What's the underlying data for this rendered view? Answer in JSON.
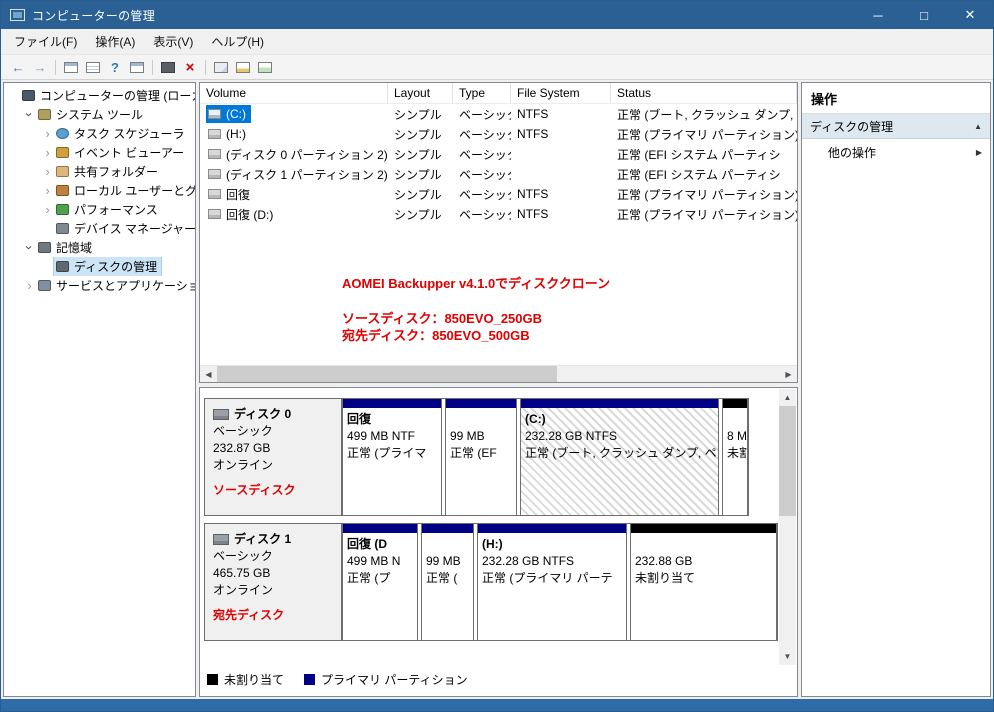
{
  "window": {
    "title": "コンピューターの管理",
    "minimize": "─",
    "maximize": "□",
    "close": "✕"
  },
  "menu": {
    "file": "ファイル(F)",
    "action": "操作(A)",
    "view": "表示(V)",
    "help": "ヘルプ(H)"
  },
  "toolbar": {
    "back": "←",
    "forward": "→",
    "help": "?",
    "delete": "×"
  },
  "icons": {
    "chevron": "›",
    "left": "◀",
    "right": "▶",
    "up": "▲",
    "down": "▼",
    "section_collapse": "▲",
    "submenu": "▶"
  },
  "tree": {
    "items": [
      {
        "label": "コンピューターの管理 (ローカ"
      },
      {
        "label": "システム ツール"
      },
      {
        "label": "タスク スケジューラ"
      },
      {
        "label": "イベント ビューアー"
      },
      {
        "label": "共有フォルダー"
      },
      {
        "label": "ローカル ユーザーとグル"
      },
      {
        "label": "パフォーマンス"
      },
      {
        "label": "デバイス マネージャー"
      },
      {
        "label": "記憶域"
      },
      {
        "label": "ディスクの管理"
      },
      {
        "label": "サービスとアプリケーション"
      }
    ]
  },
  "volume_table": {
    "columns": {
      "volume": "Volume",
      "layout": "Layout",
      "type": "Type",
      "fs": "File System",
      "status": "Status"
    },
    "rows": [
      {
        "volume": "(C:)",
        "layout": "シンプル",
        "type": "ベーシック",
        "fs": "NTFS",
        "status": "正常 (ブート, クラッシュ ダンプ,"
      },
      {
        "volume": "(H:)",
        "layout": "シンプル",
        "type": "ベーシック",
        "fs": "NTFS",
        "status": "正常 (プライマリ パーティション)"
      },
      {
        "volume": "(ディスク 0 パーティション 2)",
        "layout": "シンプル",
        "type": "ベーシック",
        "fs": "",
        "status": "正常 (EFI システム パーティシ"
      },
      {
        "volume": "(ディスク 1 パーティション 2)",
        "layout": "シンプル",
        "type": "ベーシック",
        "fs": "",
        "status": "正常 (EFI システム パーティシ"
      },
      {
        "volume": "回復",
        "layout": "シンプル",
        "type": "ベーシック",
        "fs": "NTFS",
        "status": "正常 (プライマリ パーティション)"
      },
      {
        "volume": "回復 (D:)",
        "layout": "シンプル",
        "type": "ベーシック",
        "fs": "NTFS",
        "status": "正常 (プライマリ パーティション)"
      }
    ]
  },
  "annotation": {
    "line1": "AOMEI Backupper v4.1.0でディスククローン",
    "line2": "ソースディスク：850EVO_250GB",
    "line3": "宛先ディスク：850EVO_500GB"
  },
  "disks": [
    {
      "name": "ディスク 0",
      "kind": "ベーシック",
      "size": "232.87 GB",
      "status": "オンライン",
      "note": "ソースディスク",
      "partitions": [
        {
          "title": "回復",
          "size": "499 MB NTF",
          "status": "正常 (プライマ"
        },
        {
          "title": "",
          "size": "99 MB",
          "status": "正常 (EF"
        },
        {
          "title": "(C:)",
          "size": "232.28 GB NTFS",
          "status": "正常 (ブート, クラッシュ ダンプ, ペ"
        },
        {
          "title": "",
          "size": "8 M",
          "status": "未割"
        }
      ]
    },
    {
      "name": "ディスク 1",
      "kind": "ベーシック",
      "size": "465.75 GB",
      "status": "オンライン",
      "note": "宛先ディスク",
      "partitions": [
        {
          "title": "回復 (D",
          "size": "499 MB N",
          "status": "正常 (プ"
        },
        {
          "title": "",
          "size": "99 MB",
          "status": "正常 ("
        },
        {
          "title": "(H:)",
          "size": "232.28 GB NTFS",
          "status": "正常 (プライマリ パーテ"
        },
        {
          "title": "",
          "size": "232.88 GB",
          "status": "未割り当て"
        }
      ]
    }
  ],
  "legend": {
    "unallocated": "未割り当て",
    "primary": "プライマリ パーティション"
  },
  "actions": {
    "title": "操作",
    "section": "ディスクの管理",
    "more": "他の操作"
  },
  "colors": {
    "titlebar": "#2a6094",
    "selection": "#0078d7",
    "primary_partition": "#000084",
    "unallocated": "#000000",
    "annotation_red": "#e00000"
  }
}
